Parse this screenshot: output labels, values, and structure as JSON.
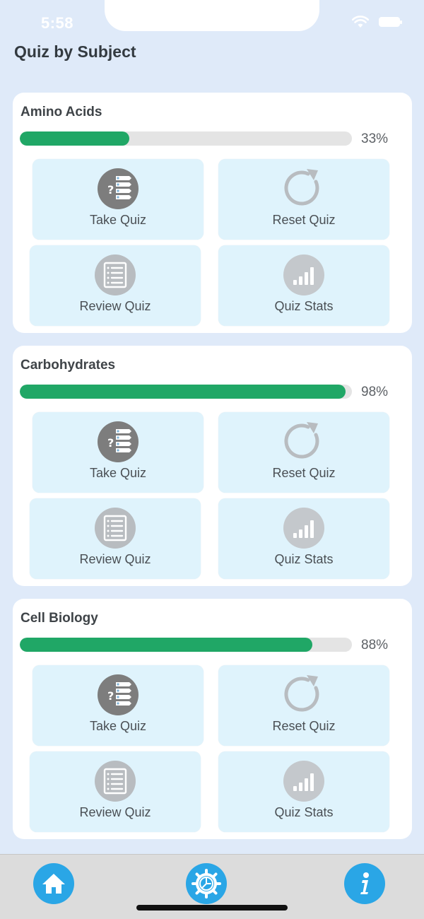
{
  "status_bar": {
    "time": "5:58"
  },
  "header": {
    "title": "Quiz by Subject"
  },
  "actions": {
    "take": "Take Quiz",
    "reset": "Reset Quiz",
    "review": "Review Quiz",
    "stats": "Quiz Stats"
  },
  "subjects": [
    {
      "name": "Amino Acids",
      "progress_label": "33%",
      "progress": 0.33
    },
    {
      "name": "Carbohydrates",
      "progress_label": "98%",
      "progress": 0.98
    },
    {
      "name": "Cell Biology",
      "progress_label": "88%",
      "progress": 0.88
    }
  ],
  "tab_bar": {
    "icons": [
      "home-icon",
      "settings-icon",
      "info-icon"
    ]
  },
  "colors": {
    "background": "#dfeaf9",
    "progress_fill": "#20a766",
    "progress_track": "#e4e4e4",
    "tile": "#dff3fc",
    "tab_accent": "#2aa6e6"
  }
}
